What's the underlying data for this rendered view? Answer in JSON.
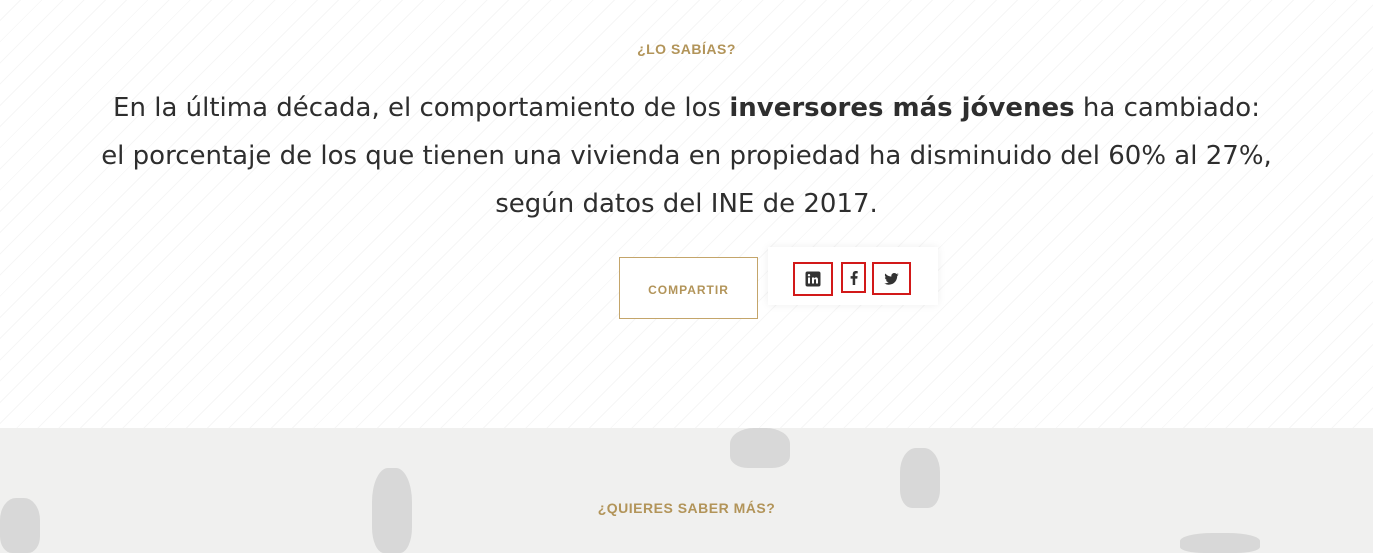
{
  "did_you_know": {
    "eyebrow": "¿LO SABÍAS?",
    "text_part1": "En la última década, el comportamiento de los ",
    "text_bold": "inversores más jóvenes",
    "text_part2": " ha cambiado: el porcentaje de los que tienen una vivienda en propiedad ha disminuido del 60% al 27%, según datos del INE de 2017.",
    "share_label": "COMPARTIR"
  },
  "social": [
    {
      "name": "linkedin",
      "icon": "linkedin-icon"
    },
    {
      "name": "facebook",
      "icon": "facebook-icon"
    },
    {
      "name": "twitter",
      "icon": "twitter-icon"
    }
  ],
  "more": {
    "eyebrow": "¿QUIERES SABER MÁS?"
  },
  "colors": {
    "accent": "#b29459",
    "text": "#2e2e2e",
    "highlight_box": "#d21919",
    "bottom_bg": "#f0f0ef"
  }
}
